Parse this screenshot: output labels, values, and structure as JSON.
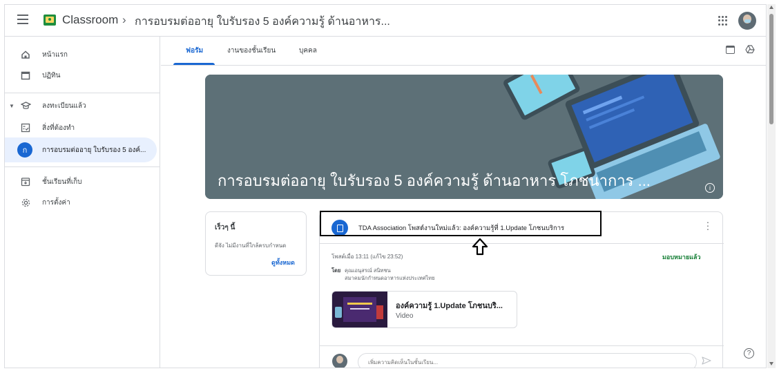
{
  "header": {
    "app_title": "Classroom",
    "separator": "›",
    "class_name": "การอบรมต่ออายุ ใบรับรอง 5 องค์ความรู้ ด้านอาหาร..."
  },
  "sidebar": {
    "items": [
      {
        "label": "หน้าแรก",
        "icon": "home-icon"
      },
      {
        "label": "ปฏิทิน",
        "icon": "calendar-icon"
      },
      {
        "label": "ลงทะเบียนแล้ว",
        "icon": "school-icon"
      },
      {
        "label": "สิ่งที่ต้องทำ",
        "icon": "todo-icon"
      },
      {
        "label": "การอบรมต่ออายุ ใบรับรอง 5 องค์...",
        "icon": "class-avatar",
        "badge": "ก"
      },
      {
        "label": "ชั้นเรียนที่เก็บ",
        "icon": "archive-icon"
      },
      {
        "label": "การตั้งค่า",
        "icon": "settings-icon"
      }
    ]
  },
  "tabs": [
    {
      "label": "ฟอรัม",
      "active": true
    },
    {
      "label": "งานของชั้นเรียน",
      "active": false
    },
    {
      "label": "บุคคล",
      "active": false
    }
  ],
  "banner": {
    "title": "การอบรมต่ออายุ ใบรับรอง 5 องค์ความรู้ ด้านอาหาร โภชนาการ ...",
    "info": "i"
  },
  "upcoming": {
    "title": "เร็วๆ นี้",
    "text": "ดีจัง ไม่มีงานที่ใกล้ครบกำหนด",
    "link": "ดูทั้งหมด"
  },
  "post": {
    "title": "TDA Association โพสต์งานใหม่แล้ว: องค์ความรู้ที่ 1.Update โภชนบริการ",
    "time": "โพสต์เมื่อ 13:11 (แก้ไข 23:52)",
    "status": "มอบหมายแล้ว",
    "by_label": "โดย",
    "by_name": "คุณเอนุสรณ์ สนิทชน",
    "by_org": "สมาคมนักกำหนดอาหารแห่งประเทศไทย",
    "attachment": {
      "title": "องค์ความรู้ 1.Update โภชนบริ...",
      "type": "Video"
    },
    "comment_placeholder": "เพิ่มความคิดเห็นในชั้นเรียน..."
  },
  "help": "?",
  "colors": {
    "accent": "#1967d2",
    "assigned": "#188038",
    "banner": "#5f7178"
  }
}
